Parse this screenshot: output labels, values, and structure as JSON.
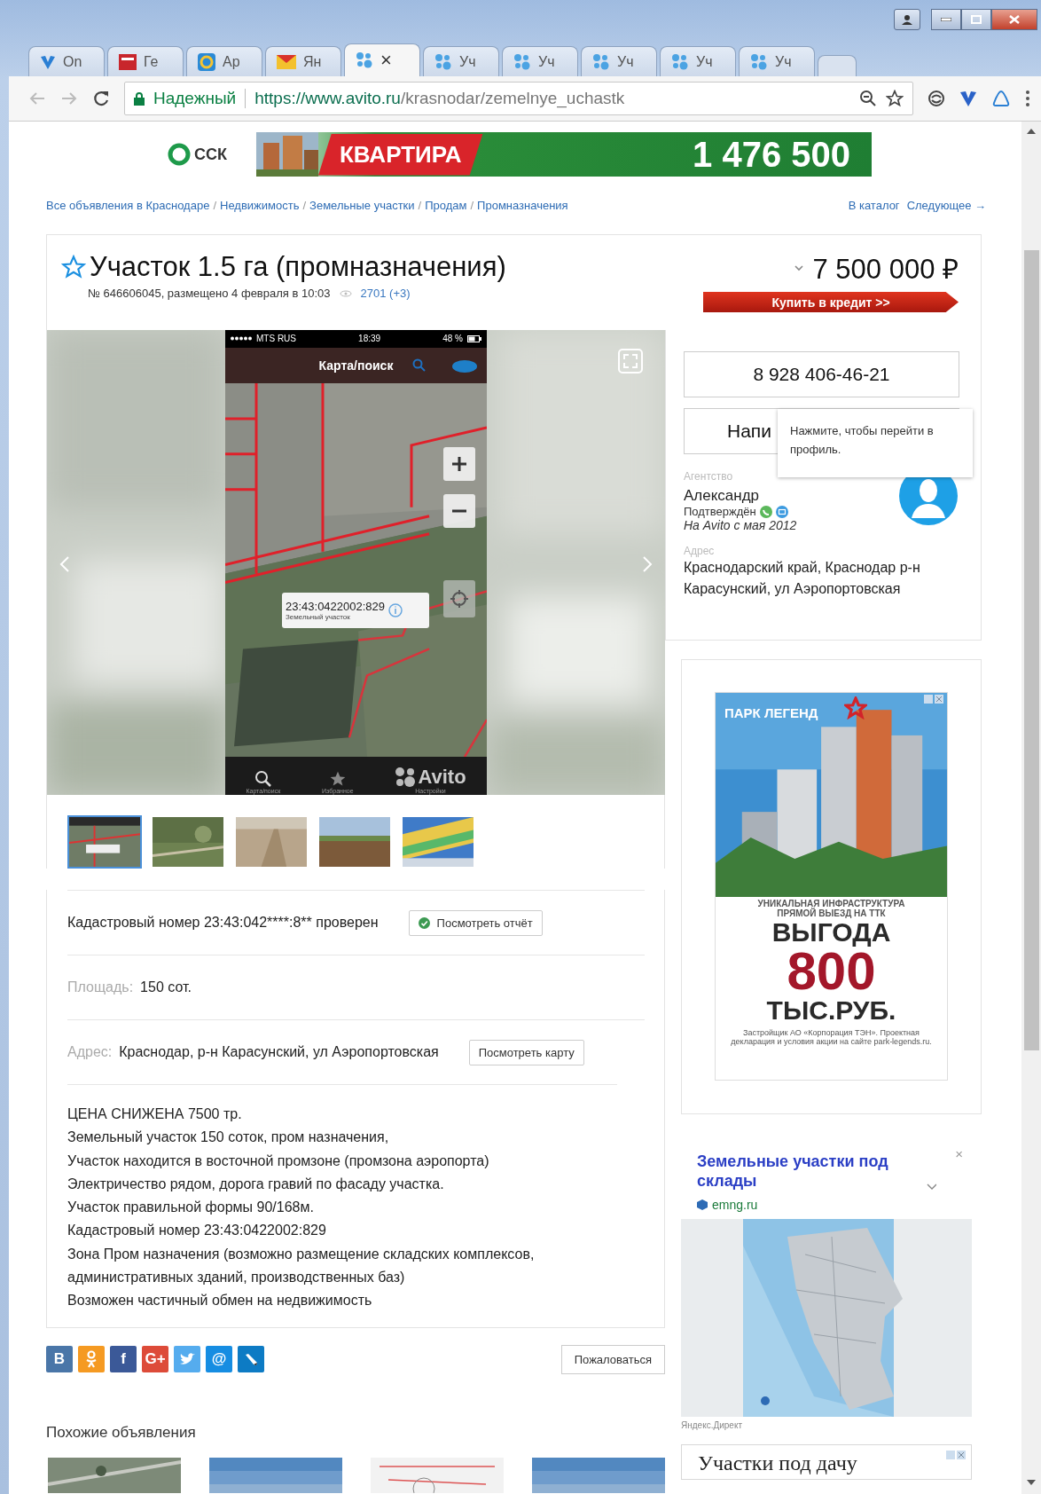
{
  "tabs": [
    {
      "kind": "vshape",
      "label": "On",
      "selected": false
    },
    {
      "kind": "badge",
      "label": "Ге",
      "selected": false
    },
    {
      "kind": "ring",
      "label": "Ap",
      "selected": false
    },
    {
      "kind": "envelope",
      "label": "Ян",
      "selected": false
    },
    {
      "kind": "dots",
      "close": "×",
      "selected": true
    },
    {
      "kind": "dots",
      "label": "Уч",
      "selected": false
    },
    {
      "kind": "dots",
      "label": "Уч",
      "selected": false
    },
    {
      "kind": "dots",
      "label": "Уч",
      "selected": false
    },
    {
      "kind": "dots",
      "label": "Уч",
      "selected": false
    },
    {
      "kind": "dots",
      "label": "Уч",
      "selected": false
    }
  ],
  "toolbar": {
    "security": "Надежный",
    "url_main": "https://www.avito.ru",
    "url_rest": "/krasnodar/zemelnye_uchastk"
  },
  "banner": {
    "brand": "ССК",
    "headline": "КВАРТИРА",
    "price": "1 476 500"
  },
  "breadcrumbs": {
    "separator": "/",
    "items": [
      "Все объявления в Краснодаре",
      "Недвижимость",
      "Земельные участки",
      "Продам",
      "Промназначения"
    ]
  },
  "nav_links": [
    "В каталог",
    "Следующее →"
  ],
  "listing": {
    "favorite": false,
    "title": "Участок 1.5 га (промназначения)",
    "meta": "№ 646606045, размещено 4 февраля в 10:03",
    "views": "2701 (+3)",
    "price": "7 500 000 ₽",
    "credit_button": "Купить в кредит >>"
  },
  "gallery": {
    "phone": {
      "carrier": "MTS RUS",
      "time": "18:39",
      "battery": "48 %",
      "title": "Карта/поиск",
      "popup_title": "23:43:0422002:829",
      "popup_subtitle": "Земельный участок",
      "logo": "Avito",
      "tabs": [
        "Карта/поиск",
        "Избранное",
        "Настройки"
      ]
    },
    "thumbnails": [
      {
        "kind": "picture",
        "selected": true
      },
      {
        "kind": "picture",
        "selected": false
      },
      {
        "kind": "picture",
        "selected": false
      },
      {
        "kind": "picture",
        "selected": false
      },
      {
        "kind": "picture",
        "selected": false
      }
    ]
  },
  "seller": {
    "phone": "8 928 406-46-21",
    "write_button": "Напи",
    "tooltip": "Нажмите, чтобы перейти в профиль.",
    "type_label": "Агентство",
    "name": "Александр",
    "verified": "Подтверждён",
    "since": "На Avito с мая 2012",
    "address_label": "Адрес",
    "address": "Краснодарский край, Краснодар р-н Карасунский, ул Аэропортовская"
  },
  "details": [
    {
      "kind": "check",
      "text": "Кадастровый номер 23:43:042****:8** проверен",
      "button": "Посмотреть отчёт"
    },
    {
      "kind": "param",
      "label": "Площадь:",
      "value": "150 сот."
    },
    {
      "kind": "param",
      "label": "Адрес:",
      "value": "Краснодар, р-н Карасунский, ул Аэропортовская",
      "button": "Посмотреть карту"
    }
  ],
  "description": [
    "ЦЕНА СНИЖЕНА 7500 тр.",
    "Земельный участок 150 соток, пром назначения,",
    "Участок находится в восточной промзоне (промзона аэропорта)",
    "Электричество рядом, дорога гравий по фасаду участка.",
    "Участок правильной формы 90/168м.",
    "Кадастровый номер 23:43:0422002:829",
    "Зона Пром назначения (возможно размещение складских комплексов, административных зданий, производственных баз)",
    "Возможен частичный обмен на недвижимость"
  ],
  "share": [
    {
      "kind": "letter",
      "glyph": "В",
      "color": "#4a76a8"
    },
    {
      "kind": "person",
      "color": "#f59a22"
    },
    {
      "kind": "letter",
      "glyph": "f",
      "color": "#3b5998"
    },
    {
      "kind": "letter",
      "glyph": "G+",
      "color": "#dd4b39"
    },
    {
      "kind": "bird",
      "color": "#55acee"
    },
    {
      "kind": "letter",
      "glyph": "@",
      "color": "#168de2"
    },
    {
      "kind": "pencil",
      "color": "#0d7bc4"
    }
  ],
  "complain_button": "Пожаловаться",
  "similar": {
    "title": "Похожие объявления",
    "items": [
      {
        "kind": "picture"
      },
      {
        "kind": "picture"
      },
      {
        "kind": "picture"
      },
      {
        "kind": "picture"
      }
    ]
  },
  "promo_ad": {
    "brand": "ПАРК ЛЕГЕНД",
    "tagline_1": "УНИКАЛЬНАЯ ИНФРАСТРУКТУРА",
    "tagline_2": "ПРЯМОЙ ВЫЕЗД НА ТТК",
    "benefit": "ВЫГОДА",
    "amount": "800",
    "unit": "ТЫС.РУБ.",
    "disclaimer": "Застройщик АО «Корпорация ТЭН». Проектная декларация и условия акции на сайте park-legends.ru."
  },
  "text_ad": {
    "title": "Земельные участки под склады",
    "close": "×",
    "domain": "emng.ru",
    "footer": "Яндекс.Директ"
  },
  "bottom_ad": {
    "title": "Участки под дачу"
  }
}
